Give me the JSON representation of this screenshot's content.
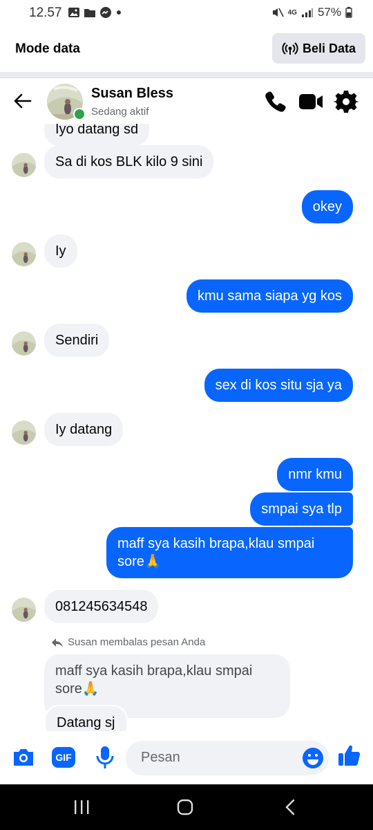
{
  "status_bar": {
    "time": "12.57",
    "battery": "57%",
    "network": "4G"
  },
  "data_banner": {
    "title": "Mode data",
    "buy_label": "Beli Data"
  },
  "chat_header": {
    "name": "Susan Bless",
    "status": "Sedang aktif"
  },
  "messages": {
    "partial_top": "Iyo datang sd",
    "m1": "Sa di kos BLK kilo 9 sini",
    "m2": "okey",
    "m3": "Iy",
    "m4": "kmu sama siapa yg kos",
    "m5": "Sendiri",
    "m6": "sex di kos situ sja ya",
    "m7": "Iy datang",
    "m8": "nmr kmu",
    "m9": "smpai sya tlp",
    "m10_line1": "maff sya kasih brapa,klau smpai",
    "m10_line2": "sore🙏",
    "m11": "081245634548",
    "reply_note": "Susan membalas pesan Anda",
    "quoted_line1": "maff sya kasih brapa,klau smpai",
    "quoted_line2": "sore🙏",
    "m12": "Datang sj"
  },
  "composer": {
    "placeholder": "Pesan",
    "gif_label": "GIF"
  },
  "colors": {
    "accent": "#0866ff",
    "incoming_bubble": "#f0f2f5",
    "online": "#31a24c"
  },
  "icons": [
    "image-icon",
    "folder-icon",
    "messenger-icon",
    "mute-icon",
    "signal-icon",
    "battery-icon",
    "hotspot-icon",
    "back-arrow-icon",
    "phone-icon",
    "video-icon",
    "gear-icon",
    "camera-icon",
    "gif-icon",
    "mic-icon",
    "emoji-icon",
    "thumbs-up-icon",
    "recents-icon",
    "home-icon",
    "back-icon",
    "reply-icon"
  ]
}
